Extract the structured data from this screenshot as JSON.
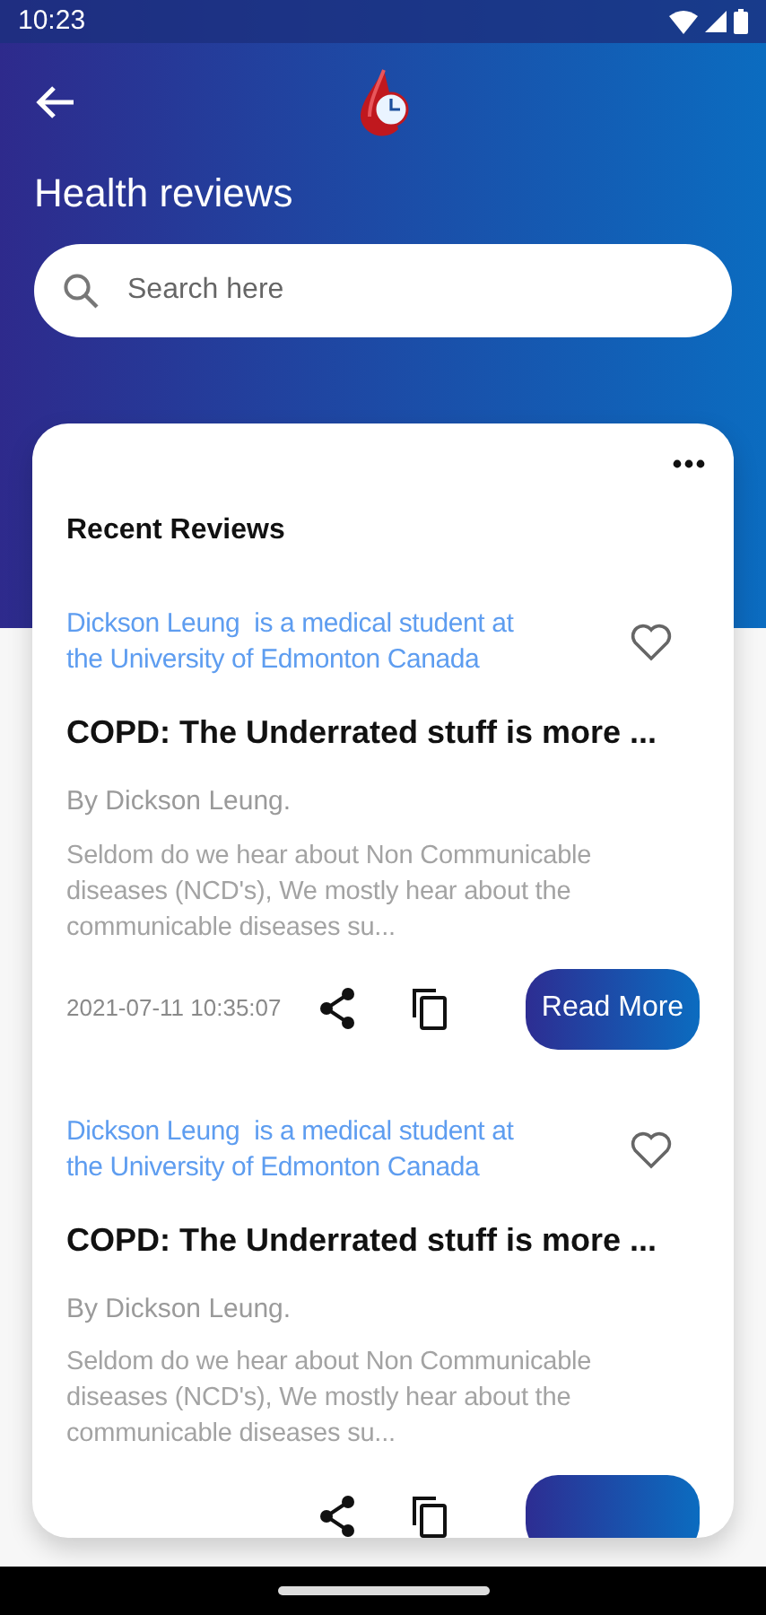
{
  "status_bar": {
    "time": "10:23"
  },
  "header": {
    "title": "Health reviews"
  },
  "search": {
    "placeholder": "Search here"
  },
  "section": {
    "title": "Recent Reviews"
  },
  "reviews": [
    {
      "author_note": "Dickson Leung  is a medical student at the University of Edmonton Canada",
      "liked": false,
      "title": "COPD: The Underrated stuff is more ...",
      "byline": "By Dickson Leung.",
      "excerpt": "Seldom do we hear about Non Communicable diseases (NCD's), We mostly hear about the communicable diseases su...",
      "date": "2021-07-11 10:35:07",
      "button": "Read More"
    },
    {
      "author_note": "Dickson Leung  is a medical student at the University of Edmonton Canada",
      "liked": false,
      "title": "COPD: The Underrated stuff is more ...",
      "byline": "By Dickson Leung.",
      "excerpt": "Seldom do we hear about Non Communicable diseases (NCD's), We mostly hear about the communicable diseases su..."
    }
  ]
}
